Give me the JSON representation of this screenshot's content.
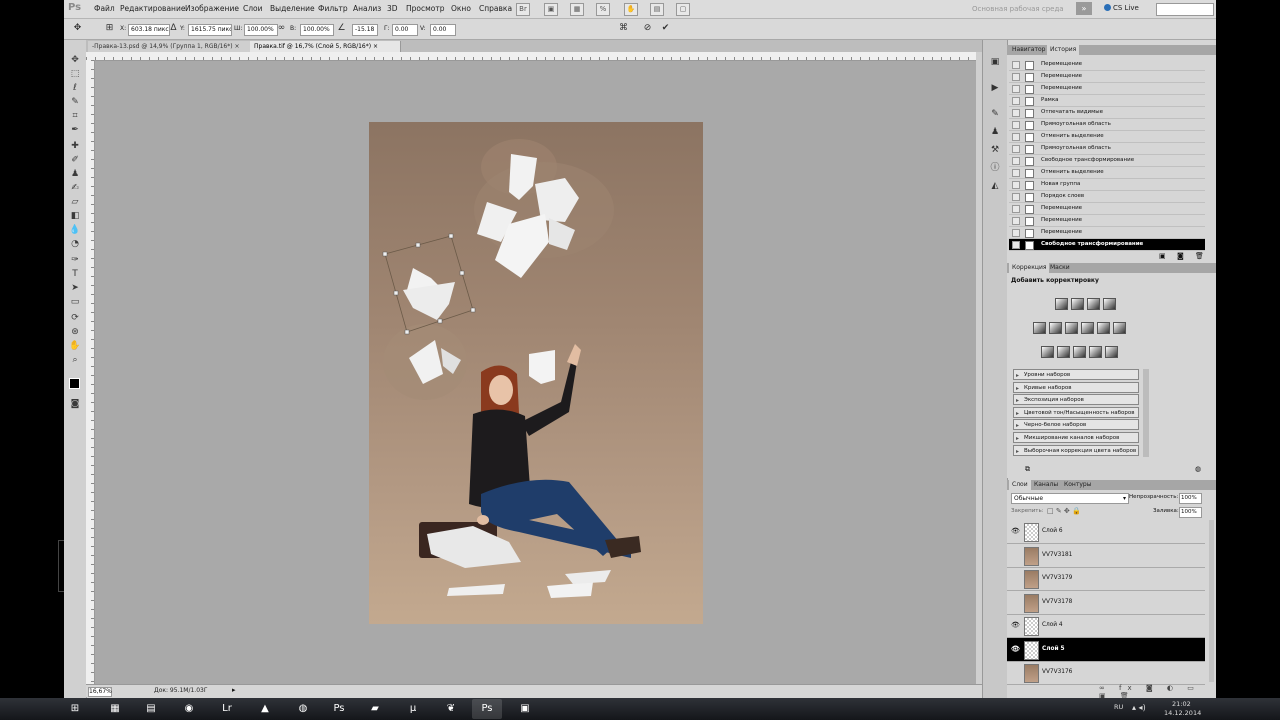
{
  "menu": {
    "app_logo": "Ps",
    "items": [
      "Файл",
      "Редактирование",
      "Изображение",
      "Слои",
      "Выделение",
      "Фильтр",
      "Анализ",
      "3D",
      "Просмотр",
      "Окно",
      "Справка"
    ],
    "workspace": "Основная рабочая среда",
    "cs_live": "CS Live"
  },
  "options": {
    "x_label": "X:",
    "x_value": "603.18 пикс",
    "y_label": "Y:",
    "y_value": "1615.75 пикс",
    "w_label": "Ш:",
    "w_value": "100.00%",
    "h_label": "В:",
    "h_value": "100.00%",
    "angle_value": "-15.18",
    "g_label": "Г:",
    "g_value": "0.00",
    "v_label": "V:",
    "v_value": "0.00"
  },
  "tabs": [
    {
      "label": "-Правка-13.psd @ 14,9% (Группа 1, RGB/16*)"
    },
    {
      "label": "Правка.tif @ 16,7% (Слой 5, RGB/16*)"
    }
  ],
  "status": {
    "zoom": "16,67%",
    "doc": "Док: 95.1M/1.03Г"
  },
  "history": {
    "tabs": [
      "Навигатор",
      "История"
    ],
    "items": [
      "Перемещение",
      "Перемещение",
      "Перемещение",
      "Рамка",
      "Отпечатать видимые",
      "Прямоугольная область",
      "Отменить выделение",
      "Прямоугольная область",
      "Свободное трансформирование",
      "Отменить выделение",
      "Новая группа",
      "Порядок слоев",
      "Перемещение",
      "Перемещение",
      "Перемещение",
      "Свободное трансформирование"
    ]
  },
  "adjustments": {
    "tabs": [
      "Коррекция",
      "Маски"
    ],
    "heading": "Добавить корректировку",
    "presets": [
      "Уровни наборов",
      "Кривые наборов",
      "Экспозиция наборов",
      "Цветовой тон/Насыщенность наборов",
      "Черно-белое наборов",
      "Микширование каналов наборов",
      "Выборочная коррекция цвета наборов"
    ]
  },
  "layers": {
    "tabs": [
      "Слои",
      "Каналы",
      "Контуры"
    ],
    "blend_mode": "Обычные",
    "opacity_label": "Непрозрачность:",
    "opacity": "100%",
    "lock_label": "Закрепить:",
    "fill_label": "Заливка:",
    "fill": "100%",
    "items": [
      {
        "name": "Слой 6",
        "visible": true,
        "thumb": "checker"
      },
      {
        "name": "VV7V3181",
        "visible": false,
        "thumb": "photo"
      },
      {
        "name": "VV7V3179",
        "visible": false,
        "thumb": "photo"
      },
      {
        "name": "VV7V3178",
        "visible": false,
        "thumb": "photo"
      },
      {
        "name": "Слой 4",
        "visible": true,
        "thumb": "checker"
      },
      {
        "name": "Слой 5",
        "visible": true,
        "thumb": "checker",
        "selected": true
      },
      {
        "name": "VV7V3176",
        "visible": false,
        "thumb": "photo"
      }
    ]
  },
  "taskbar": {
    "lang": "RU",
    "time": "21:02",
    "date": "14.12.2014"
  }
}
